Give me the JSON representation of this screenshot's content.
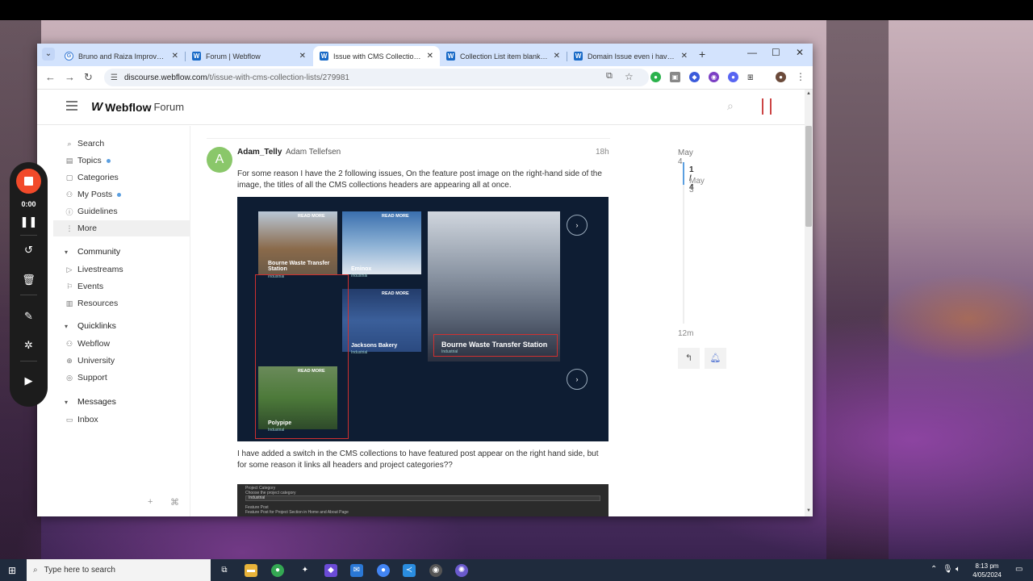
{
  "browser": {
    "tabs": [
      {
        "title": "Bruno and Raiza Improvement",
        "favicon": "G"
      },
      {
        "title": "Forum | Webflow",
        "favicon": "W"
      },
      {
        "title": "Issue with CMS Collection Lists",
        "favicon": "W"
      },
      {
        "title": "Collection List item blank areas",
        "favicon": "W"
      },
      {
        "title": "Domain Issue even i have the",
        "favicon": "W"
      }
    ],
    "url_host": "discourse.webflow.com",
    "url_path": "/t/issue-with-cms-collection-lists/279981"
  },
  "site": {
    "logo_mark": "W",
    "logo_name": "Webflow",
    "logo_suffix": "Forum"
  },
  "sidebar": {
    "items": [
      {
        "label": "Search",
        "icon": "search-icon"
      },
      {
        "label": "Topics",
        "icon": "topics-icon"
      },
      {
        "label": "Categories",
        "icon": "categories-icon"
      },
      {
        "label": "My Posts",
        "icon": "user-icon"
      },
      {
        "label": "Guidelines",
        "icon": "info-icon"
      },
      {
        "label": "More",
        "icon": "more-icon"
      }
    ],
    "community_title": "Community",
    "community": [
      {
        "label": "Livestreams",
        "icon": "play-icon"
      },
      {
        "label": "Events",
        "icon": "flag-icon"
      },
      {
        "label": "Resources",
        "icon": "book-icon"
      }
    ],
    "quicklinks_title": "Quicklinks",
    "quicklinks": [
      {
        "label": "Webflow",
        "icon": "webflow-icon"
      },
      {
        "label": "University",
        "icon": "globe-icon"
      },
      {
        "label": "Support",
        "icon": "support-icon"
      }
    ],
    "messages_title": "Messages",
    "messages": [
      {
        "label": "Inbox",
        "icon": "inbox-icon"
      }
    ]
  },
  "post": {
    "avatar_letter": "A",
    "username": "Adam_Telly",
    "fullname": "Adam Tellefsen",
    "time": "18h",
    "p1": "For some reason I have the 2 following issues, On the feature post image on the right-hand side of the image, the titles of all the CMS collections headers are appearing all at once.",
    "p2": "I have added a switch in the CMS collections to have featured post appear on the right hand side, but for some reason it links all headers and project categories??"
  },
  "shot1": {
    "read_more": "READ MORE",
    "tiles": [
      {
        "title": "Bourne Waste Transfer Station",
        "sub": "Industrial"
      },
      {
        "title": "Eminox",
        "sub": "Industrial"
      },
      {
        "title": "Jacksons Bakery",
        "sub": "Industrial"
      },
      {
        "title": "Polypipe",
        "sub": "Industrial"
      }
    ],
    "featured_title": "Bourne Waste Transfer Station",
    "featured_sub": "Industrial"
  },
  "shot2": {
    "label1": "Project Category",
    "label2": "Choose the project category",
    "select_value": "Industrial",
    "label3": "Feature Post",
    "label4": "Feature Post for Project Section in Home and About Page"
  },
  "timeline": {
    "date_top": "May 4",
    "count": "1 / 4",
    "date": "May 3",
    "ago": "12m"
  },
  "recorder": {
    "time": "0:00"
  },
  "taskbar": {
    "search_placeholder": "Type here to search",
    "time": "8:13 pm",
    "date": "4/05/2024"
  }
}
